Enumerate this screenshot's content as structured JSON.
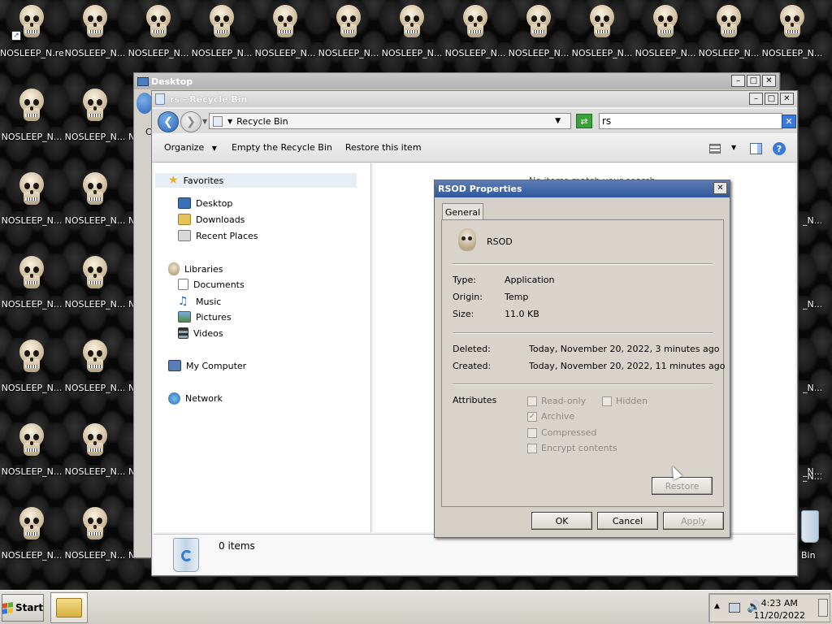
{
  "desktop": {
    "icon_label": "NOSLEEP_N...",
    "first_icon_label": "NOSLEEP_N.re",
    "right_partial_labels": [
      "_N...",
      "_N...",
      "_N...",
      "_N...",
      "_N..."
    ],
    "left_partial_label": "N",
    "bin_label": "Bin"
  },
  "desktop_window": {
    "title": "Desktop",
    "partial_letter": "C"
  },
  "recycle_window": {
    "title": "rs - Recycle Bin",
    "address": "Recycle Bin",
    "search_value": "rs",
    "toolbar": {
      "organize": "Organize",
      "empty": "Empty the Recycle Bin",
      "restore": "Restore this item"
    },
    "nav": {
      "favorites": "Favorites",
      "desktop": "Desktop",
      "downloads": "Downloads",
      "recent_places": "Recent Places",
      "libraries": "Libraries",
      "documents": "Documents",
      "music": "Music",
      "pictures": "Pictures",
      "videos": "Videos",
      "my_computer": "My Computer",
      "network": "Network"
    },
    "content_partial": "No items match your search.",
    "details_count": "0 items"
  },
  "dialog": {
    "title": "RSOD Properties",
    "tab_general": "General",
    "file_name": "RSOD",
    "type_label": "Type:",
    "type_value": "Application",
    "origin_label": "Origin:",
    "origin_value": "Temp",
    "size_label": "Size:",
    "size_value": "11.0 KB",
    "deleted_label": "Deleted:",
    "deleted_value": "Today, November 20, 2022, 3 minutes ago",
    "created_label": "Created:",
    "created_value": "Today, November 20, 2022, 11 minutes ago",
    "attributes_label": "Attributes",
    "attr_readonly": "Read-only",
    "attr_hidden": "Hidden",
    "attr_archive": "Archive",
    "attr_compressed": "Compressed",
    "attr_encrypt": "Encrypt contents",
    "restore_btn": "Restore",
    "ok_btn": "OK",
    "cancel_btn": "Cancel",
    "apply_btn": "Apply"
  },
  "taskbar": {
    "start_label": "Start",
    "time": "4:23 AM",
    "date": "11/20/2022"
  },
  "colors": {
    "dialog_title": "#2f58a0",
    "nav_blue": "#2a62b8",
    "search_clear": "#3a7ad8"
  }
}
